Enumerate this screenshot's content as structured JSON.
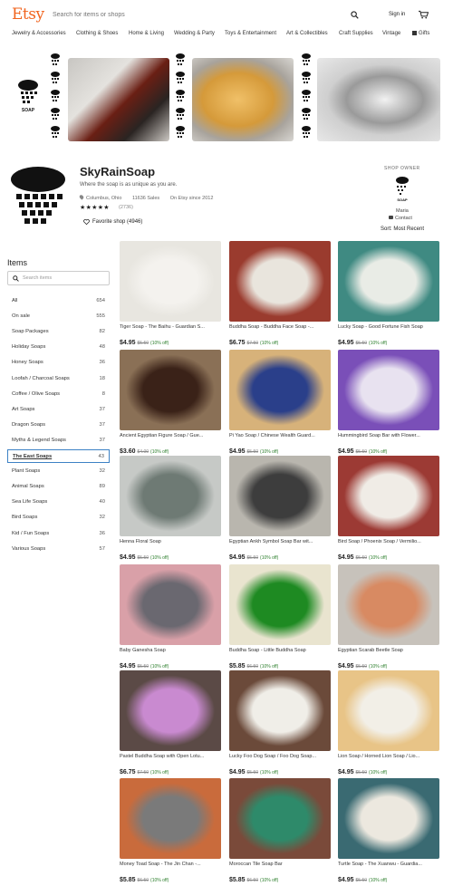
{
  "header": {
    "logo": "Etsy",
    "search_placeholder": "Search for items or shops",
    "signin": "Sign in"
  },
  "nav": [
    {
      "label": "Jewelry & Accessories"
    },
    {
      "label": "Clothing & Shoes"
    },
    {
      "label": "Home & Living"
    },
    {
      "label": "Wedding & Party"
    },
    {
      "label": "Toys & Entertainment"
    },
    {
      "label": "Art & Collectibles"
    },
    {
      "label": "Craft Supplies"
    },
    {
      "label": "Vintage"
    },
    {
      "label": "Gifts"
    }
  ],
  "banner": {
    "logo_text": "SOAP"
  },
  "shop": {
    "name": "SkyRainSoap",
    "tagline": "Where the soap is as unique as you are.",
    "location": "Columbus, Ohio",
    "sales": "11636 Sales",
    "since": "On Etsy since 2012",
    "stars": "★★★★★",
    "reviews": "(2736)",
    "favorite": "Favorite shop (4946)"
  },
  "owner": {
    "label": "SHOP OWNER",
    "avatar_text": "SOAP",
    "name": "Maria",
    "contact": "Contact",
    "sort": "Sort: Most Recent"
  },
  "sidebar": {
    "title": "Items",
    "search_placeholder": "Search items",
    "categories": [
      {
        "label": "All",
        "count": "654"
      },
      {
        "label": "On sale",
        "count": "555"
      },
      {
        "label": "Soap Packages",
        "count": "82"
      },
      {
        "label": "Holiday Soaps",
        "count": "48"
      },
      {
        "label": "Honey Soaps",
        "count": "36"
      },
      {
        "label": "Loofah / Charcoal Soaps",
        "count": "18"
      },
      {
        "label": "Coffee / Olive Soaps",
        "count": "8"
      },
      {
        "label": "Art Soaps",
        "count": "37"
      },
      {
        "label": "Dragon Soaps",
        "count": "37"
      },
      {
        "label": "Myths & Legend Soaps",
        "count": "37"
      },
      {
        "label": "The East Soaps",
        "count": "43"
      },
      {
        "label": "Plant Soaps",
        "count": "32"
      },
      {
        "label": "Animal Soaps",
        "count": "89"
      },
      {
        "label": "Sea Life Soaps",
        "count": "40"
      },
      {
        "label": "Bird Soaps",
        "count": "32"
      },
      {
        "label": "Kid / Fun Soaps",
        "count": "36"
      },
      {
        "label": "Various Soaps",
        "count": "57"
      }
    ]
  },
  "products": [
    {
      "title": "Tiger Soap - The Baihu - Guardian S...",
      "price": "$4.95",
      "orig": "$5.50",
      "off": "(10% off)",
      "bg": "#e8e6e0",
      "fg": "#f4f2ee"
    },
    {
      "title": "Buddha Soap - Buddha Face Soap -...",
      "price": "$6.75",
      "orig": "$7.50",
      "off": "(10% off)",
      "bg": "#9a3b2e",
      "fg": "#e9e5dd"
    },
    {
      "title": "Lucky Soap - Good Fortune Fish Soap",
      "price": "$4.95",
      "orig": "$5.50",
      "off": "(10% off)",
      "bg": "#3f8a82",
      "fg": "#e9ece6"
    },
    {
      "title": "Ancient Egyptian Figure Soap / Gue...",
      "price": "$3.60",
      "orig": "$4.00",
      "off": "(10% off)",
      "bg": "#8a7056",
      "fg": "#3a2218"
    },
    {
      "title": "Pi Yao Soap / Chinese Wealth Guard...",
      "price": "$4.95",
      "orig": "$5.50",
      "off": "(10% off)",
      "bg": "#d7b27a",
      "fg": "#2a3f8a"
    },
    {
      "title": "Hummingbird Soap Bar with Flower...",
      "price": "$4.95",
      "orig": "$5.50",
      "off": "(10% off)",
      "bg": "#7a4fb8",
      "fg": "#e8e2f0"
    },
    {
      "title": "Henna Floral Soap",
      "price": "$4.95",
      "orig": "$5.50",
      "off": "(10% off)",
      "bg": "#c6c9c6",
      "fg": "#6e7a74"
    },
    {
      "title": "Egyptian Ankh Symbol Soap Bar wit...",
      "price": "$4.95",
      "orig": "$5.50",
      "off": "(10% off)",
      "bg": "#b9b6ae",
      "fg": "#3d3d3d"
    },
    {
      "title": "Bird Soap / Phoenix Soap / Vermilio...",
      "price": "$4.95",
      "orig": "$5.50",
      "off": "(10% off)",
      "bg": "#9c3a34",
      "fg": "#f0ece6"
    },
    {
      "title": "Baby Ganesha Soap",
      "price": "$4.95",
      "orig": "$5.50",
      "off": "(10% off)",
      "bg": "#d9a0a8",
      "fg": "#6a6870"
    },
    {
      "title": "Buddha Soap - Little Buddha Soap",
      "price": "$5.85",
      "orig": "$6.50",
      "off": "(10% off)",
      "bg": "#e9e4cf",
      "fg": "#1e8a22"
    },
    {
      "title": "Egyptian Scarab Beetle Soap",
      "price": "$4.95",
      "orig": "$5.50",
      "off": "(10% off)",
      "bg": "#c7c2bb",
      "fg": "#d88a62"
    },
    {
      "title": "Pastel Buddha Soap with Open Lotu...",
      "price": "$6.75",
      "orig": "$7.50",
      "off": "(10% off)",
      "bg": "#5b4a46",
      "fg": "#c98ad0"
    },
    {
      "title": "Lucky Foo Dog Soap / Foo Dog Soap...",
      "price": "$4.95",
      "orig": "$5.50",
      "off": "(10% off)",
      "bg": "#6b4a3a",
      "fg": "#f0eee8"
    },
    {
      "title": "Lion Soap / Horned Lion Soap / Lio...",
      "price": "$4.95",
      "orig": "$5.50",
      "off": "(10% off)",
      "bg": "#e8c487",
      "fg": "#f2efe7"
    },
    {
      "title": "Money Toad Soap - The Jin Chan -...",
      "price": "$5.85",
      "orig": "$6.50",
      "off": "(10% off)",
      "bg": "#c96b3c",
      "fg": "#7a7a7a"
    },
    {
      "title": "Moroccan Tile Soap Bar",
      "price": "$5.85",
      "orig": "$6.50",
      "off": "(10% off)",
      "bg": "#7a4a3a",
      "fg": "#2e8a6a"
    },
    {
      "title": "Turtle Soap - The Xuanwu - Guardia...",
      "price": "$4.95",
      "orig": "$5.50",
      "off": "(10% off)",
      "bg": "#3a6a72",
      "fg": "#ece8df"
    }
  ]
}
